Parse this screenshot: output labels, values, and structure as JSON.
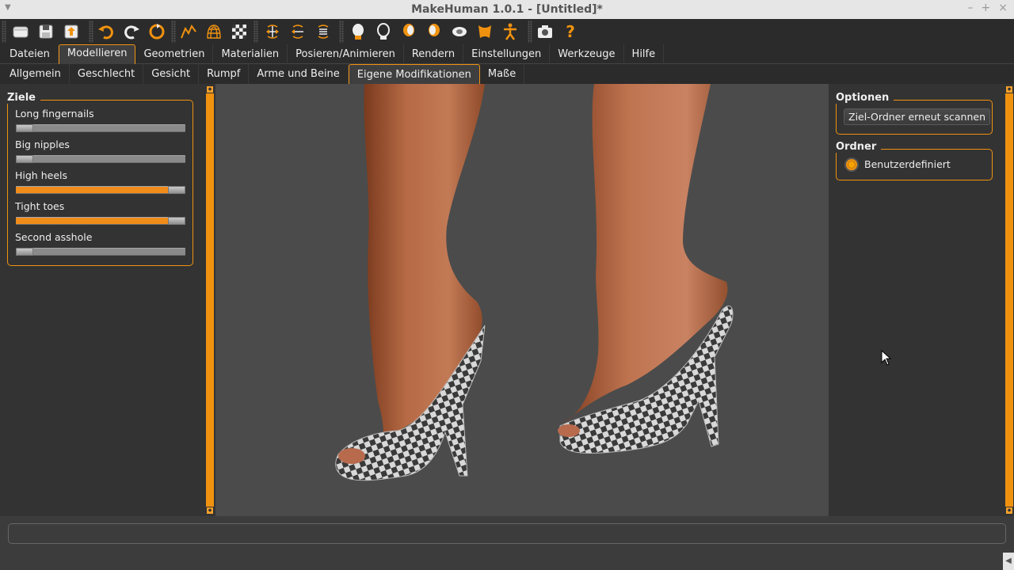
{
  "window": {
    "title": "MakeHuman 1.0.1 - [Untitled]*"
  },
  "toolbar": {
    "icons": [
      "folder-icon",
      "save-icon",
      "export-icon",
      "undo-icon",
      "redo-icon",
      "reset-icon",
      "smooth-icon",
      "wireframe-icon",
      "texture-icon",
      "front-view-icon",
      "back-view-icon",
      "top-view-icon",
      "face-icon",
      "head-left-icon",
      "head-right-icon",
      "bottom-view-icon",
      "torso-icon",
      "pose-icon",
      "camera-icon",
      "help-icon"
    ]
  },
  "main_tabs": [
    "Dateien",
    "Modellieren",
    "Geometrien",
    "Materialien",
    "Posieren/Animieren",
    "Rendern",
    "Einstellungen",
    "Werkzeuge",
    "Hilfe"
  ],
  "main_tab_active": "Modellieren",
  "sub_tabs": [
    "Allgemein",
    "Geschlecht",
    "Gesicht",
    "Rumpf",
    "Arme und Beine",
    "Eigene Modifikationen",
    "Maße"
  ],
  "sub_tab_active": "Eigene Modifikationen",
  "left_panel": {
    "group_title": "Ziele",
    "sliders": [
      {
        "label": "Long fingernails",
        "value": 0.0
      },
      {
        "label": "Big nipples",
        "value": 0.0
      },
      {
        "label": "High heels",
        "value": 1.0
      },
      {
        "label": "Tight toes",
        "value": 1.0
      },
      {
        "label": "Second asshole",
        "value": 0.0
      }
    ]
  },
  "right_panel": {
    "options_title": "Optionen",
    "rescan_button": "Ziel-Ordner erneut scannen",
    "folder_title": "Ordner",
    "folder_option": "Benutzerdefiniert"
  },
  "colors": {
    "accent": "#f0920f",
    "viewport_bg": "#4b4b4b",
    "panel_bg": "#333333"
  }
}
